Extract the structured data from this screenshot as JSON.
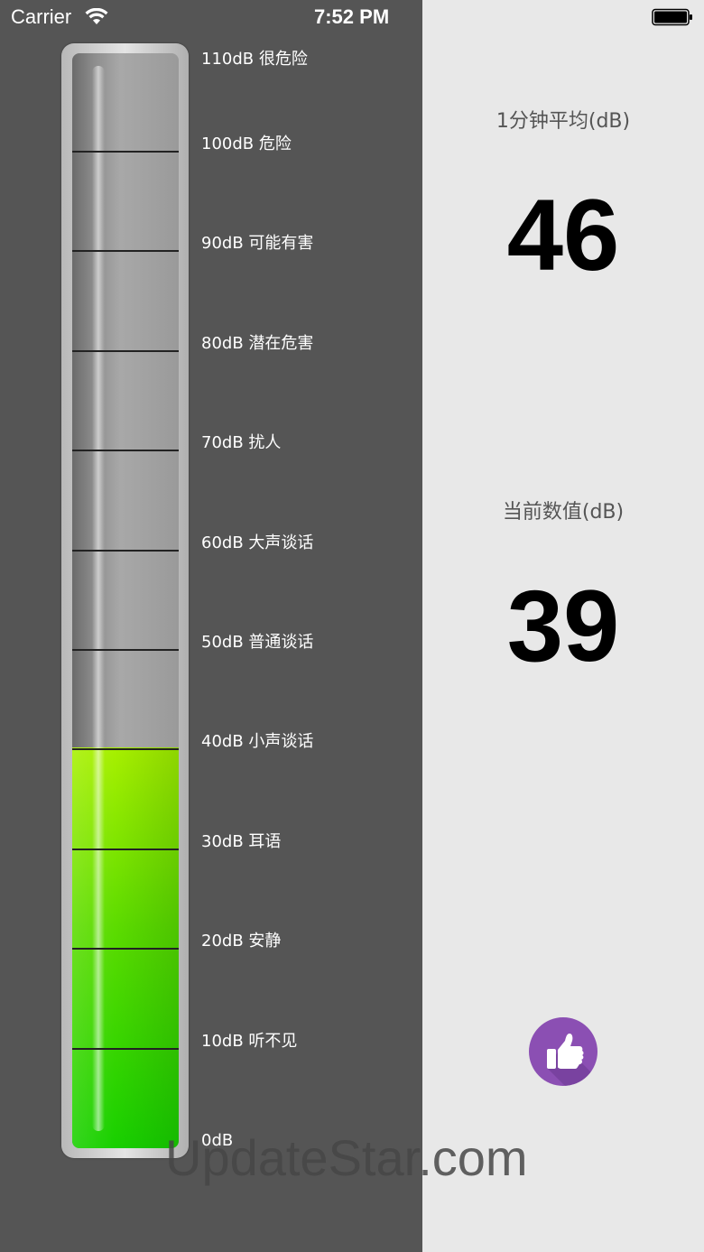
{
  "status_bar": {
    "carrier": "Carrier",
    "time": "7:52 PM",
    "wifi_icon": "wifi-icon",
    "battery_icon": "battery-icon"
  },
  "meter": {
    "level_db": 40,
    "max_db": 110,
    "scale": [
      {
        "db": 110,
        "label": "110dB 很危险"
      },
      {
        "db": 100,
        "label": "100dB 危险"
      },
      {
        "db": 90,
        "label": "90dB 可能有害"
      },
      {
        "db": 80,
        "label": "80dB 潜在危害"
      },
      {
        "db": 70,
        "label": "70dB 扰人"
      },
      {
        "db": 60,
        "label": "60dB 大声谈话"
      },
      {
        "db": 50,
        "label": "50dB 普通谈话"
      },
      {
        "db": 40,
        "label": "40dB 小声谈话"
      },
      {
        "db": 30,
        "label": "30dB 耳语"
      },
      {
        "db": 20,
        "label": "20dB 安静"
      },
      {
        "db": 10,
        "label": "10dB 听不见"
      },
      {
        "db": 0,
        "label": "0dB"
      }
    ],
    "fill_color": "#5cdc00"
  },
  "stats": {
    "avg_title": "1分钟平均(dB)",
    "avg_value": "46",
    "current_title": "当前数值(dB)",
    "current_value": "39"
  },
  "like_button": {
    "icon": "thumbs-up-icon",
    "color": "#8b4fb3"
  },
  "watermark": "UpdateStar.com"
}
